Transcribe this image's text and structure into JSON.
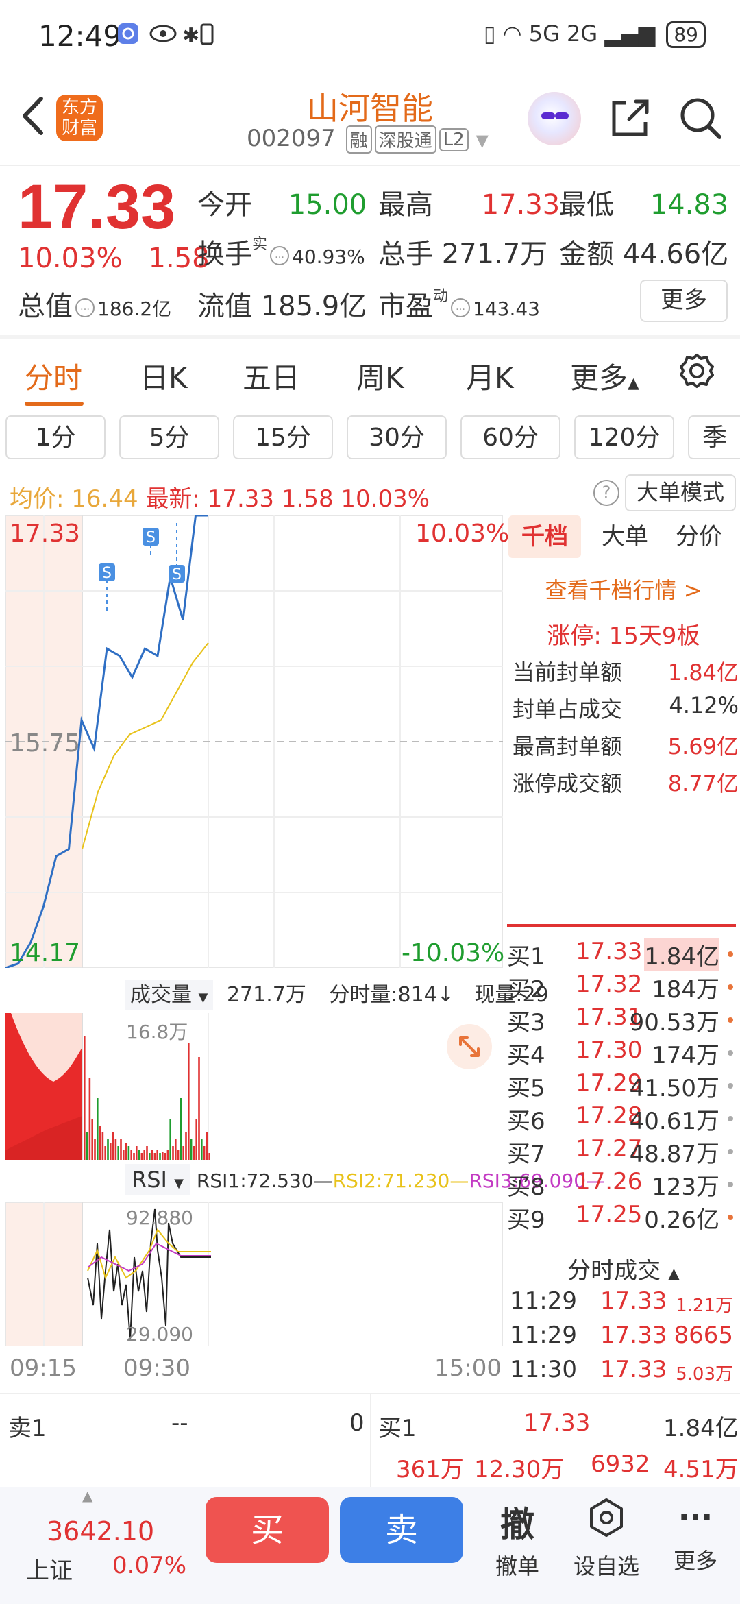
{
  "status_bar": {
    "time": "12:49",
    "network": "5G 2G",
    "battery": "89"
  },
  "header": {
    "logo_line1": "东方",
    "logo_line2": "财富",
    "stock_name": "山河智能",
    "stock_code": "002097",
    "tags": [
      "融",
      "深股通",
      "L2"
    ]
  },
  "quote": {
    "price": "17.33",
    "change_pct": "10.03%",
    "change_amt": "1.58",
    "open_label": "今开",
    "open_value": "15.00",
    "high_label": "最高",
    "high_value": "17.33",
    "low_label": "最低",
    "low_value": "14.83",
    "turnover_label": "换手",
    "turnover_sup": "实",
    "turnover_value": "40.93%",
    "volume_label": "总手",
    "volume_value": "271.7万",
    "amount_label": "金额",
    "amount_value": "44.66亿",
    "mktcap_label": "总值",
    "mktcap_value": "186.2亿",
    "float_label": "流值",
    "float_value": "185.9亿",
    "pe_label": "市盈",
    "pe_sup": "动",
    "pe_value": "143.43",
    "more_label": "更多"
  },
  "period_tabs": [
    "分时",
    "日K",
    "五日",
    "周K",
    "月K",
    "更多"
  ],
  "minute_tabs": [
    "1分",
    "5分",
    "15分",
    "30分",
    "60分",
    "120分",
    "季"
  ],
  "avg_bar": {
    "avg_label": "均价:",
    "avg_value": "16.44",
    "latest_label": "最新:",
    "latest_price": "17.33",
    "latest_chg": "1.58",
    "latest_pct": "10.03%",
    "mode_label": "大单模式"
  },
  "chart_data": {
    "type": "line",
    "title": "",
    "y_top": "17.33",
    "y_mid": "15.75",
    "y_bottom": "14.17",
    "pct_top": "10.03%",
    "pct_bottom": "-10.03%",
    "x_ticks": [
      "09:15",
      "09:30",
      "15:00"
    ],
    "markers": [
      "S",
      "S",
      "S"
    ],
    "ylim": [
      14.17,
      17.33
    ],
    "series": [
      {
        "values": [
          14.17,
          14.2,
          14.35,
          14.6,
          14.95,
          15.0,
          15.9,
          15.7,
          16.4,
          16.35,
          16.2,
          16.4,
          16.35,
          16.9,
          16.6,
          17.33,
          17.33
        ]
      },
      {
        "values": [
          15.0,
          15.4,
          15.65,
          15.8,
          15.85,
          15.9,
          16.1,
          16.3,
          16.44
        ]
      }
    ]
  },
  "volume_panel": {
    "label": "成交量",
    "total": "271.7万",
    "minute_vol": "分时量:814↓",
    "current": "现量:29",
    "max_label": "16.8万"
  },
  "rsi_panel": {
    "label": "RSI",
    "rsi1": "RSI1:72.530—",
    "rsi2": "RSI2:71.230—",
    "rsi3": "RSI3:69.090—",
    "max_label": "92.880",
    "min_label": "29.090"
  },
  "right_panel": {
    "tabs": [
      "千档",
      "大单",
      "分价"
    ],
    "view_link": "查看千档行情 >",
    "limit_up": "涨停: 15天9板",
    "seal": [
      {
        "label": "当前封单额",
        "value": "1.84亿"
      },
      {
        "label": "封单占成交",
        "value": "4.12%"
      },
      {
        "label": "最高封单额",
        "value": "5.69亿"
      },
      {
        "label": "涨停成交额",
        "value": "8.77亿"
      }
    ],
    "order_book": [
      {
        "level": "买1",
        "price": "17.33",
        "vol": "1.84亿"
      },
      {
        "level": "买2",
        "price": "17.32",
        "vol": "184万"
      },
      {
        "level": "买3",
        "price": "17.31",
        "vol": "90.53万"
      },
      {
        "level": "买4",
        "price": "17.30",
        "vol": "174万"
      },
      {
        "level": "买5",
        "price": "17.29",
        "vol": "41.50万"
      },
      {
        "level": "买6",
        "price": "17.28",
        "vol": "40.61万"
      },
      {
        "level": "买7",
        "price": "17.27",
        "vol": "48.87万"
      },
      {
        "level": "买8",
        "price": "17.26",
        "vol": "123万"
      },
      {
        "level": "买9",
        "price": "17.25",
        "vol": "0.26亿"
      }
    ],
    "ticks_title": "分时成交",
    "ticks": [
      {
        "time": "11:29",
        "price": "17.33",
        "vol": "1.21万"
      },
      {
        "time": "11:29",
        "price": "17.33",
        "vol": "8665"
      },
      {
        "time": "11:30",
        "price": "17.33",
        "vol": "5.03万"
      }
    ]
  },
  "order_strip": {
    "sell1_label": "卖1",
    "sell1_price": "--",
    "sell1_vol": "0",
    "buy1_label": "买1",
    "buy1_price": "17.33",
    "buy1_vol": "1.84亿",
    "stat1": "361万",
    "stat2": "12.30万",
    "stat3": "6932",
    "stat4": "4.51万"
  },
  "bottom_nav": {
    "index_value": "3642.10",
    "index_name": "上证",
    "index_pct": "0.07%",
    "buy": "买",
    "sell": "卖",
    "cancel_icon": "撤",
    "cancel": "撤单",
    "watch": "设自选",
    "more": "更多"
  }
}
